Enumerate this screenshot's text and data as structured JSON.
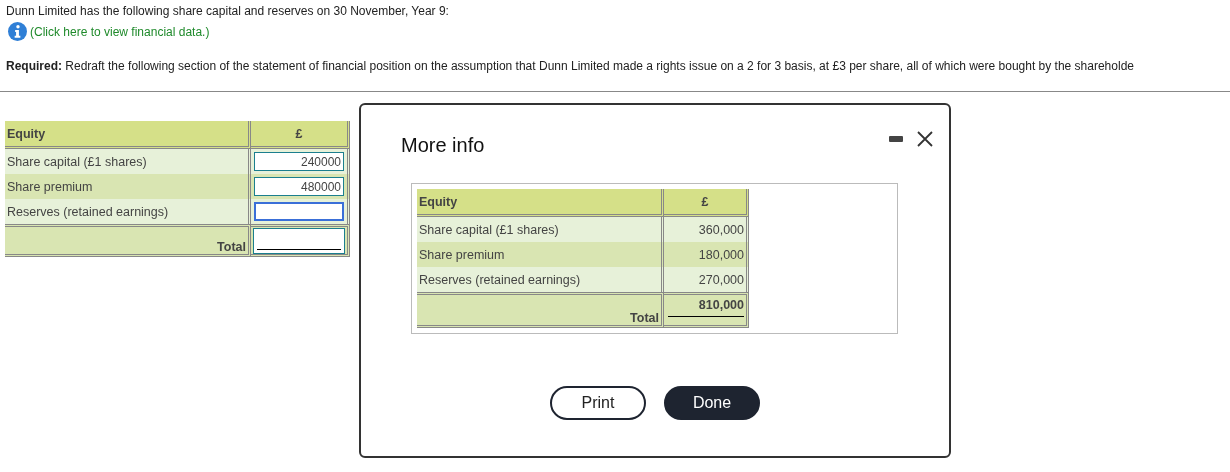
{
  "intro": "Dunn Limited has the following share capital and reserves on 30 November, Year 9:",
  "info_link": "(Click here to view financial data.)",
  "required": "**Required:** Redraft the following section of the statement of financial position on the assumption that Dunn Limited made a rights issue on a 2 for 3 basis, at £3 per share, all of which were bought by the shareholde",
  "answer_table": {
    "columns": [
      "Equity",
      "£"
    ],
    "rows": [
      {
        "label": "Share capital (£1 shares)",
        "value": "240000",
        "focused": false
      },
      {
        "label": "Share premium",
        "value": "480000",
        "focused": false
      },
      {
        "label": "Reserves (retained earnings)",
        "focused": true
      }
    ],
    "total": {
      "label": "Total",
      "focused": false
    }
  },
  "modal": {
    "title": "More info",
    "table": {
      "columns": [
        "Equity",
        "£"
      ],
      "rows": [
        {
          "label": "Share capital (£1 shares)",
          "value": "360,000"
        },
        {
          "label": "Share premium",
          "value": "180,000"
        },
        {
          "label": "Reserves (retained earnings)",
          "value": "270,000"
        }
      ],
      "total": {
        "label": "Total",
        "value": "810,000"
      }
    },
    "buttons": [
      {
        "label": "Print",
        "kind": "secondary"
      },
      {
        "label": "Done",
        "kind": "primary"
      }
    ]
  }
}
